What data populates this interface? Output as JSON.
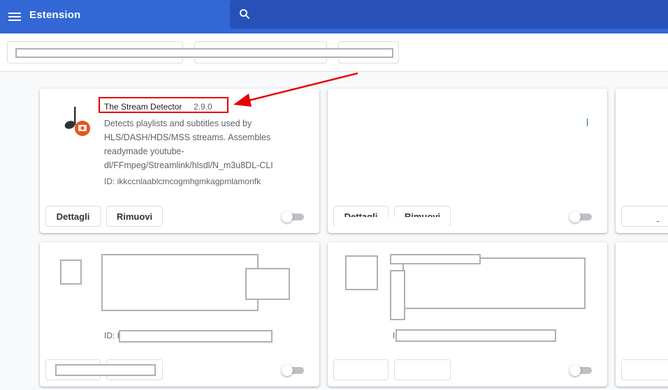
{
  "header": {
    "title": "Estension"
  },
  "cards": [
    {
      "name": "The Stream Detector",
      "version": "2.9.0",
      "description": "Detects playlists and subtitles used by HLS/DASH/HDS/MSS streams. Assembles readymade youtube-dl/FFmpeg/Streamlink/hlsdl/N_m3u8DL-CLI",
      "id": "ID: ikkccnlaablcmcogmhgmkagpmlamonfk",
      "details_label": "Dettagli",
      "remove_label": "Rimuovi",
      "enabled": false
    },
    {
      "details_label": "Dettagli",
      "remove_label": "Rimuovi",
      "enabled": false
    },
    {
      "id_prefix": "ID: I",
      "enabled": false
    },
    {
      "id_prefix": "I",
      "enabled": false
    }
  ],
  "colors": {
    "accent": "#3367d6",
    "highlight": "#e60000",
    "icon_badge": "#e8541f"
  }
}
